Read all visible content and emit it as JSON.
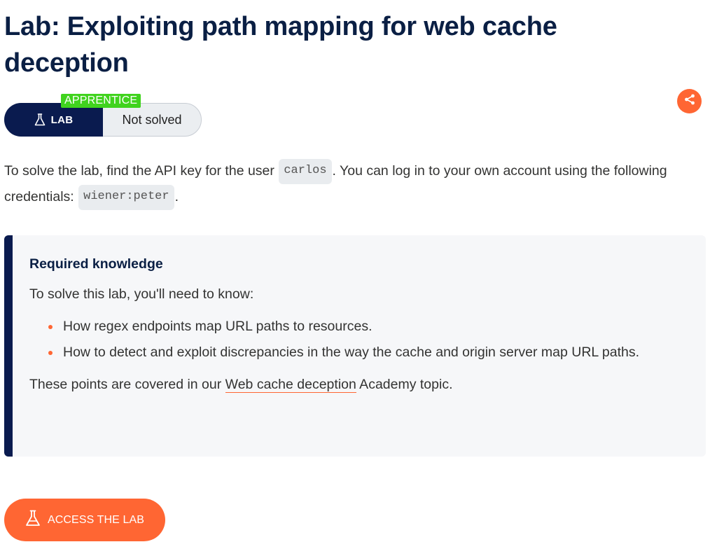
{
  "title": "Lab: Exploiting path mapping for web cache deception",
  "badge": {
    "level": "APPRENTICE",
    "type_label": "LAB",
    "status": "Not solved"
  },
  "share": {
    "icon": "share-icon"
  },
  "description": {
    "part1": "To solve the lab, find the API key for the user ",
    "user_code": "carlos",
    "part2": ". You can log in to your own account using the following credentials: ",
    "credentials_code": "wiener:peter",
    "part3": "."
  },
  "knowledge": {
    "heading": "Required knowledge",
    "intro": "To solve this lab, you'll need to know:",
    "items": [
      {
        "text": "How regex endpoints map URL paths to resources."
      },
      {
        "text": "How to detect and exploit discrepancies in the way the cache and origin server map URL paths."
      }
    ],
    "footer_before": "These points are covered in our ",
    "footer_link": "Web cache deception",
    "footer_after": " Academy topic."
  },
  "access_button": {
    "label": "ACCESS THE LAB",
    "icon": "flask-icon"
  },
  "colors": {
    "accent": "#ff6633",
    "navy": "#0a1b4f",
    "level_green": "#40d31e",
    "panel_bg": "#f6f7f9"
  }
}
